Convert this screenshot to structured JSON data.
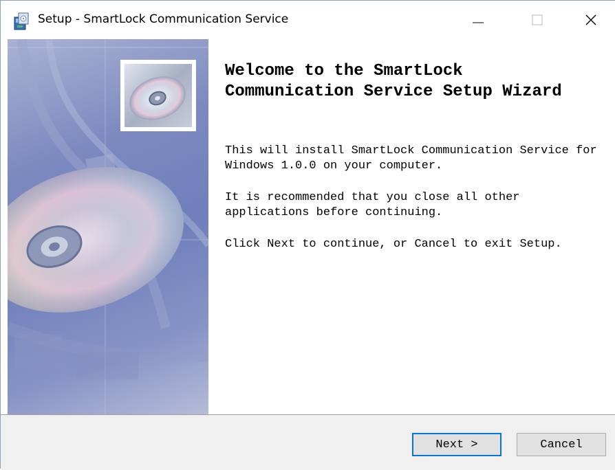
{
  "window": {
    "title": "Setup - SmartLock Communication Service"
  },
  "titlebar": {
    "minimize_icon": "minimize-icon",
    "maximize_icon": "maximize-icon",
    "close_icon": "close-icon"
  },
  "content": {
    "heading": "Welcome to the SmartLock Communication Service Setup Wizard",
    "paragraph1": "This will install SmartLock Communication Service for Windows 1.0.0 on your computer.",
    "paragraph2": "It is recommended that you close all other applications before continuing.",
    "paragraph3": "Click Next to continue, or Cancel to exit Setup."
  },
  "buttons": {
    "next_label": "Next >",
    "cancel_label": "Cancel"
  },
  "colors": {
    "accent": "#0078d7",
    "footer_bg": "#f0f0f0",
    "sidebar_blue": "#7d8ac0"
  }
}
